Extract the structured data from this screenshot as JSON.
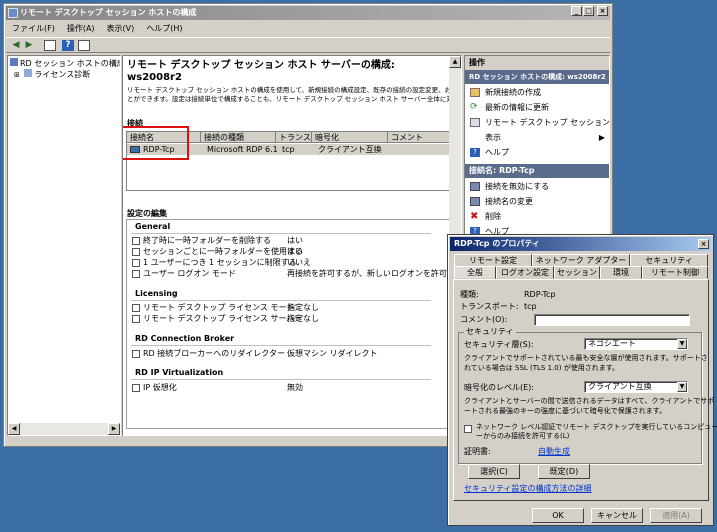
{
  "window": {
    "title": "リモート デスクトップ セッション ホストの構成",
    "min": "_",
    "max": "□",
    "close": "×"
  },
  "menu": [
    "ファイル(F)",
    "操作(A)",
    "表示(V)",
    "ヘルプ(H)"
  ],
  "tree": {
    "root": "RD セッション ホストの構成: ws2",
    "child": "ライセンス診断"
  },
  "main": {
    "heading": "リモート デスクトップ セッション ホスト サーバーの構成:",
    "server": "ws2008r2",
    "desc1": "リモート デスクトップ セッション ホストの構成を使用して、新規接続の構成設定、既存の接続の設定変更、および接続",
    "desc2": "とができます。設定は接続単位で構成することも、リモート デスクトップ セッション ホスト サーバー全体に対して構成",
    "connections_label": "接続",
    "columns": [
      "接続名",
      "接続の種類",
      "トランス...",
      "暗号化",
      "コメント"
    ],
    "row": [
      "RDP-Tcp",
      "Microsoft RDP 6.1",
      "tcp",
      "クライアント互換",
      ""
    ],
    "edit_label": "設定の編集",
    "sections": [
      {
        "title": "General",
        "items": [
          {
            "name": "終了時に一時フォルダーを削除する",
            "value": "はい"
          },
          {
            "name": "セッションごとに一時フォルダーを使用する",
            "value": "はい"
          },
          {
            "name": "1 ユーザーにつき 1 セッションに制限する",
            "value": "いいえ"
          },
          {
            "name": "ユーザー ログオン モード",
            "value": "再接続を許可するが、新しいログオンを許可しない"
          }
        ]
      },
      {
        "title": "Licensing",
        "items": [
          {
            "name": "リモート デスクトップ ライセンス モード",
            "value": "指定なし"
          },
          {
            "name": "リモート デスクトップ ライセンス サーバー",
            "value": "指定なし"
          }
        ]
      },
      {
        "title": "RD Connection Broker",
        "items": [
          {
            "name": "RD 接続ブローカーへのリダイレクター",
            "value": "仮想マシン リダイレクト"
          }
        ]
      },
      {
        "title": "RD IP Virtualization",
        "items": [
          {
            "name": "IP 仮想化",
            "value": "無効"
          }
        ]
      }
    ]
  },
  "actions": {
    "header": "操作",
    "group1": "RD セッション ホストの構成: ws2008r2",
    "items1": [
      "新規接続の作成",
      "最新の情報に更新",
      "リモート デスクトップ セッション ホスト...",
      "表示",
      "ヘルプ"
    ],
    "group2": "接続名: RDP-Tcp",
    "items2": [
      "接続を無効にする",
      "接続名の変更",
      "削除",
      "ヘルプ"
    ]
  },
  "dialog": {
    "title": "RDP-Tcp のプロパティ",
    "tabs_top": [
      "リモート設定",
      "ネットワーク アダプター",
      "セキュリティ"
    ],
    "tabs_bottom": [
      "全般",
      "ログオン設定",
      "セッション",
      "環境",
      "リモート制御"
    ],
    "type_label": "種類:",
    "type_value": "RDP-Tcp",
    "transport_label": "トランスポート:",
    "transport_value": "tcp",
    "comment_label": "コメント(O):",
    "comment_value": "",
    "security_group": "セキュリティ",
    "layer_label": "セキュリティ層(S):",
    "layer_value": "ネゴシエート",
    "layer_desc1": "クライアントでサポートされている最も安全な層が使用されます。サポートさ",
    "layer_desc2": "れている場合は SSL (TLS 1.0) が使用されます。",
    "enc_label": "暗号化のレベル(E):",
    "enc_value": "クライアント互換",
    "enc_desc1": "クライアントとサーバーの間で送信されるデータはすべて、クライアントでサポ",
    "enc_desc2": "ートされる最強のキーの強度に基づいて暗号化で保護されます。",
    "nla1": "ネットワーク レベル認証でリモート デスクトップを実行しているコンピュータ",
    "nla2": "ーからのみ接続を許可する(L)",
    "cert_label": "証明書:",
    "cert_value": "自動生成",
    "select_btn": "選択(C)",
    "default_btn": "既定(D)",
    "learn_link": "セキュリティ設定の構成方法の詳細",
    "ok": "OK",
    "cancel": "キャンセル",
    "apply": "適用(A)"
  }
}
